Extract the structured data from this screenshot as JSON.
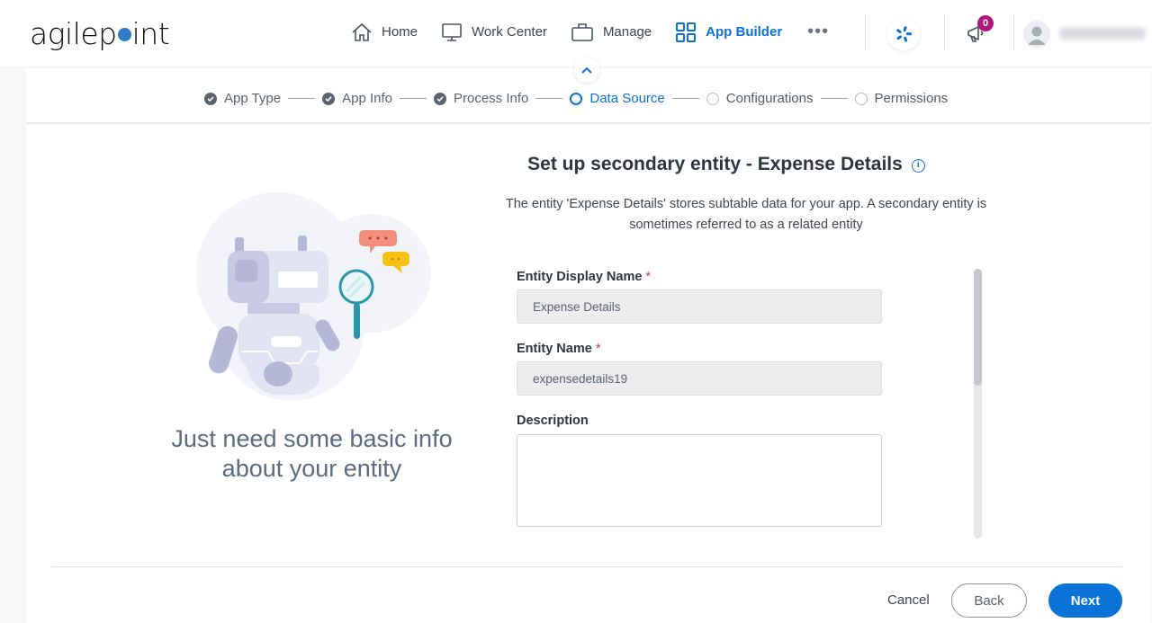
{
  "header": {
    "logo_text_pre": "agilep",
    "logo_text_post": "int",
    "nav": [
      {
        "label": "Home",
        "icon": "home-icon"
      },
      {
        "label": "Work Center",
        "icon": "monitor-icon"
      },
      {
        "label": "Manage",
        "icon": "briefcase-icon"
      },
      {
        "label": "App Builder",
        "icon": "grid-icon",
        "active": true
      }
    ],
    "more_label": "•••",
    "notifications_count": "0",
    "user_name": "Documentation"
  },
  "stepper": {
    "steps": [
      {
        "label": "App Type",
        "state": "done"
      },
      {
        "label": "App Info",
        "state": "done"
      },
      {
        "label": "Process Info",
        "state": "done"
      },
      {
        "label": "Data Source",
        "state": "current"
      },
      {
        "label": "Configurations",
        "state": "todo"
      },
      {
        "label": "Permissions",
        "state": "todo"
      }
    ]
  },
  "left_panel": {
    "tagline": "Just need some basic info about your entity"
  },
  "form": {
    "title": "Set up secondary entity - Expense Details",
    "info_icon": "i",
    "subtitle": "The entity 'Expense Details' stores subtable data for your app. A secondary entity is sometimes referred to as a related entity",
    "fields": [
      {
        "label": "Entity Display Name",
        "required": "*",
        "value": "Expense Details"
      },
      {
        "label": "Entity Name",
        "required": "*",
        "value": "expensedetails19"
      },
      {
        "label": "Description",
        "value": ""
      }
    ]
  },
  "footer": {
    "cancel_label": "Cancel",
    "back_label": "Back",
    "next_label": "Next"
  },
  "colors": {
    "accent": "#0b72d8",
    "badge": "#b0177f",
    "required": "#d0364f"
  }
}
